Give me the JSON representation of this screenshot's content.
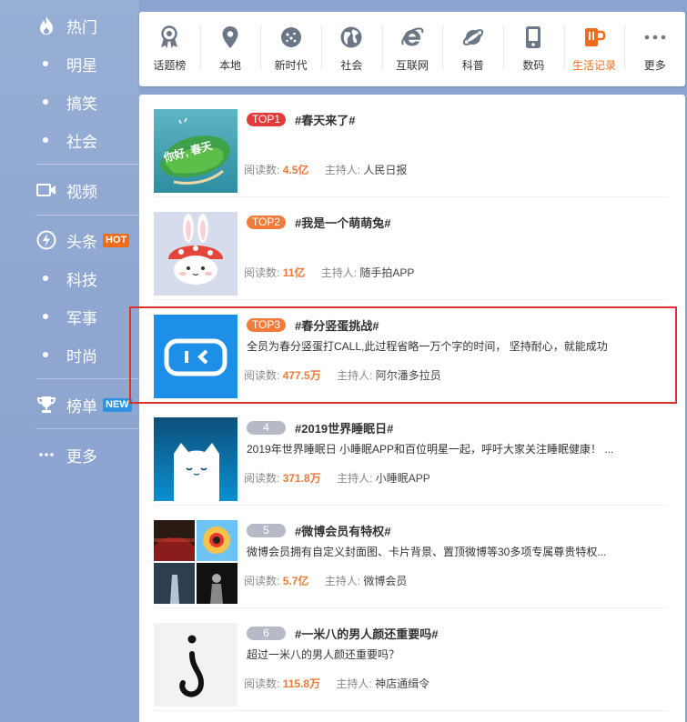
{
  "sidebar": {
    "items": [
      {
        "label": "热门",
        "icon": "fire-icon",
        "type": "section"
      },
      {
        "label": "明星",
        "type": "sub"
      },
      {
        "label": "搞笑",
        "type": "sub"
      },
      {
        "label": "社会",
        "type": "sub"
      },
      {
        "label": "视频",
        "icon": "video-icon",
        "type": "section"
      },
      {
        "label": "头条",
        "icon": "lightning-icon",
        "type": "section",
        "badge": "HOT"
      },
      {
        "label": "科技",
        "type": "sub"
      },
      {
        "label": "军事",
        "type": "sub"
      },
      {
        "label": "时尚",
        "type": "sub"
      },
      {
        "label": "榜单",
        "icon": "trophy-icon",
        "type": "section",
        "badge": "NEW"
      },
      {
        "label": "更多",
        "icon": "more-dots-icon",
        "type": "section"
      }
    ]
  },
  "categories": [
    {
      "label": "话题榜",
      "icon": "medal-icon"
    },
    {
      "label": "本地",
      "icon": "location-pin-icon"
    },
    {
      "label": "新时代",
      "icon": "star-badge-icon"
    },
    {
      "label": "社会",
      "icon": "globe-icon"
    },
    {
      "label": "互联网",
      "icon": "ie-browser-icon"
    },
    {
      "label": "科普",
      "icon": "planet-icon"
    },
    {
      "label": "数码",
      "icon": "phone-icon"
    },
    {
      "label": "生活记录",
      "icon": "cup-icon",
      "active": true
    },
    {
      "label": "更多",
      "icon": "more-icon"
    }
  ],
  "topics": [
    {
      "rank": "TOP1",
      "title": "#春天来了#",
      "desc": "",
      "reads_label": "阅读数:",
      "reads": "4.5亿",
      "host_label": "主持人:",
      "host": "人民日报",
      "thumb_text": "你好, 春天"
    },
    {
      "rank": "TOP2",
      "title": "#我是一个萌萌兔#",
      "desc": "",
      "reads_label": "阅读数:",
      "reads": "11亿",
      "host_label": "主持人:",
      "host": "随手拍APP"
    },
    {
      "rank": "TOP3",
      "title": "#春分竖蛋挑战#",
      "desc": "全员为春分竖蛋打CALL,此过程省略一万个字的时间， 坚持耐心，就能成功",
      "reads_label": "阅读数:",
      "reads": "477.5万",
      "host_label": "主持人:",
      "host": "阿尔潘多拉员"
    },
    {
      "rank": "4",
      "title": "#2019世界睡眠日#",
      "desc": "2019年世界睡眠日 小睡眠APP和百位明星一起，呼吁大家关注睡眠健康！ ...",
      "reads_label": "阅读数:",
      "reads": "371.8万",
      "host_label": "主持人:",
      "host": "小睡眠APP"
    },
    {
      "rank": "5",
      "title": "#微博会员有特权#",
      "desc": "微博会员拥有自定义封面图、卡片背景、置顶微博等30多项专属尊贵特权...",
      "reads_label": "阅读数:",
      "reads": "5.7亿",
      "host_label": "主持人:",
      "host": "微博会员"
    },
    {
      "rank": "6",
      "title": "#一米八的男人颜还重要吗#",
      "desc": "超过一米八的男人颜还重要吗？",
      "reads_label": "阅读数:",
      "reads": "115.8万",
      "host_label": "主持人:",
      "host": "神店通缉令"
    }
  ],
  "colors": {
    "sidebar_bg": "#8ea6d0",
    "accent_orange": "#f06b1b",
    "top1_red": "#e13b3b",
    "top_orange": "#f07b3b",
    "rank_gray": "#b5bac6",
    "count_orange": "#e87a39",
    "highlight_red": "#d9332c"
  }
}
